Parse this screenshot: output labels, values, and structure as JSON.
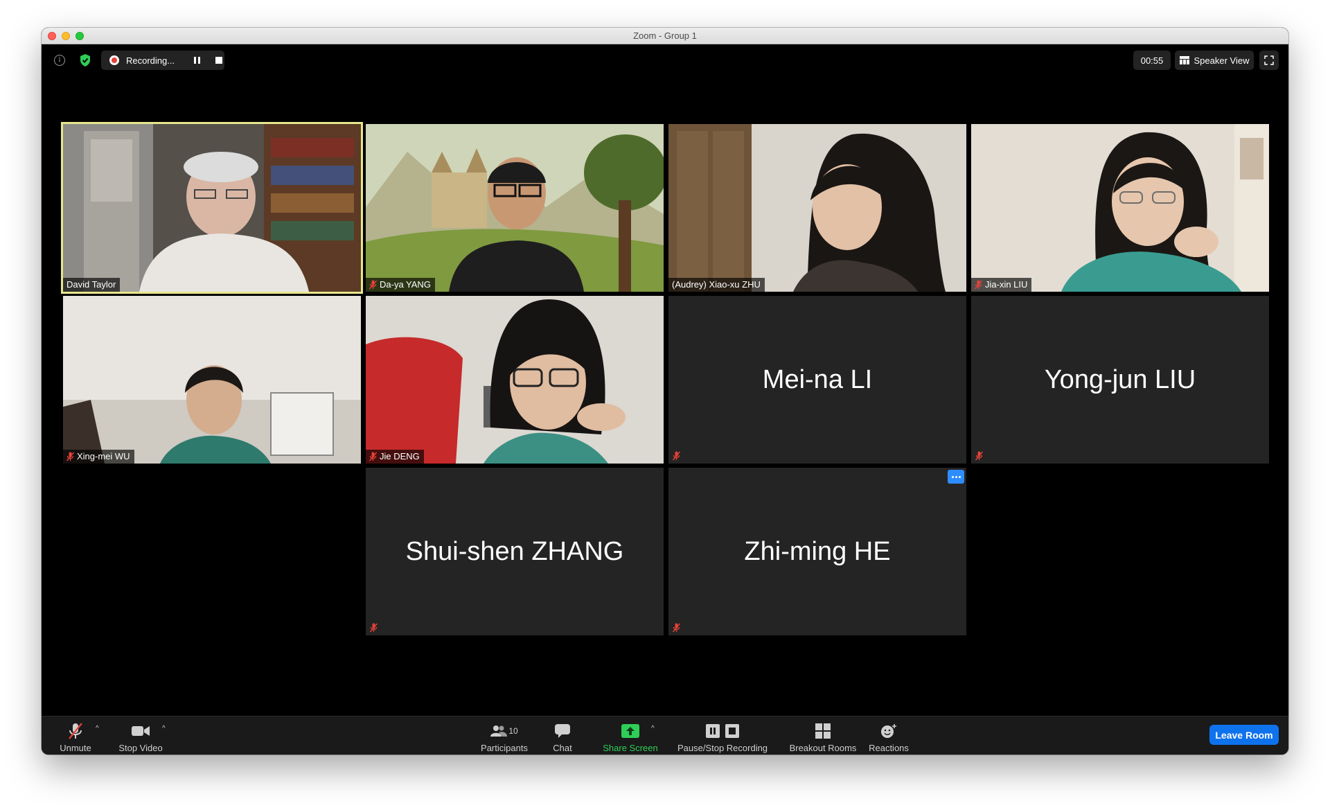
{
  "window": {
    "title": "Zoom - Group 1"
  },
  "topbar": {
    "recording_label": "Recording...",
    "timer": "00:55",
    "view_label": "Speaker View"
  },
  "participants": {
    "david": "David Taylor",
    "daya": "Da-ya YANG",
    "audrey": "(Audrey) Xiao-xu ZHU",
    "jiaxin": "Jia-xin LIU",
    "xingmei": "Xing-mei WU",
    "jie": "Jie DENG",
    "meina": "Mei-na LI",
    "yongjun": "Yong-jun LIU",
    "shuishen": "Shui-shen ZHANG",
    "zhiming": "Zhi-ming HE"
  },
  "toolbar": {
    "unmute": "Unmute",
    "stop_video": "Stop Video",
    "participants": "Participants",
    "participants_count": "10",
    "chat": "Chat",
    "share_screen": "Share Screen",
    "pause_recording": "Pause/Stop Recording",
    "breakout_rooms": "Breakout Rooms",
    "reactions": "Reactions",
    "leave": "Leave Room"
  },
  "colors": {
    "accent": "#2d8cff",
    "leave_button": "#0e72ed",
    "share_green": "#2fce57",
    "active_speaker_border": "#e6e68c",
    "muted_red": "#e5413a",
    "tile_background": "#242424"
  },
  "icons": [
    "info-icon",
    "shield-check-icon",
    "recording-icon",
    "pause-icon",
    "stop-icon",
    "speaker-view-icon",
    "fullscreen-icon",
    "microphone-muted-icon",
    "video-camera-icon",
    "participants-icon",
    "chat-icon",
    "share-screen-icon",
    "pause-stop-recording-icon",
    "breakout-rooms-icon",
    "reactions-icon",
    "more-options-icon"
  ]
}
